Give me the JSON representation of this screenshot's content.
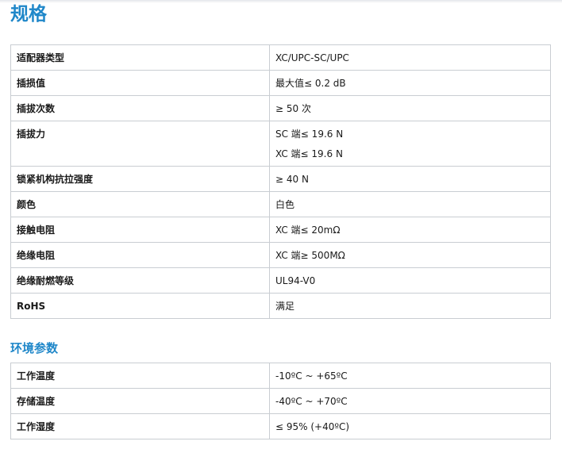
{
  "page": {
    "title": "规格"
  },
  "specs": {
    "rows": [
      {
        "name": "适配器类型",
        "values": [
          "XC/UPC-SC/UPC"
        ]
      },
      {
        "name": "插损值",
        "values": [
          "最大值≤ 0.2 dB"
        ]
      },
      {
        "name": "插拔次数",
        "values": [
          "≥ 50 次"
        ]
      },
      {
        "name": "插拔力",
        "values": [
          "SC 端≤ 19.6 N",
          "XC 端≤ 19.6 N"
        ]
      },
      {
        "name": "锁紧机构抗拉强度",
        "values": [
          "≥ 40 N"
        ]
      },
      {
        "name": "颜色",
        "values": [
          "白色"
        ]
      },
      {
        "name": "接触电阻",
        "values": [
          "XC 端≤ 20mΩ"
        ]
      },
      {
        "name": "绝缘电阻",
        "values": [
          "XC 端≥ 500MΩ"
        ]
      },
      {
        "name": "绝缘耐燃等级",
        "values": [
          "UL94-V0"
        ]
      },
      {
        "name": "RoHS",
        "values": [
          "满足"
        ]
      }
    ]
  },
  "environment": {
    "title": "环境参数",
    "rows": [
      {
        "name": "工作温度",
        "values": [
          "-10ºC ~ +65ºC"
        ]
      },
      {
        "name": "存储温度",
        "values": [
          "-40ºC ~ +70ºC"
        ]
      },
      {
        "name": "工作湿度",
        "values": [
          "≤ 95% (+40ºC)"
        ]
      }
    ]
  }
}
